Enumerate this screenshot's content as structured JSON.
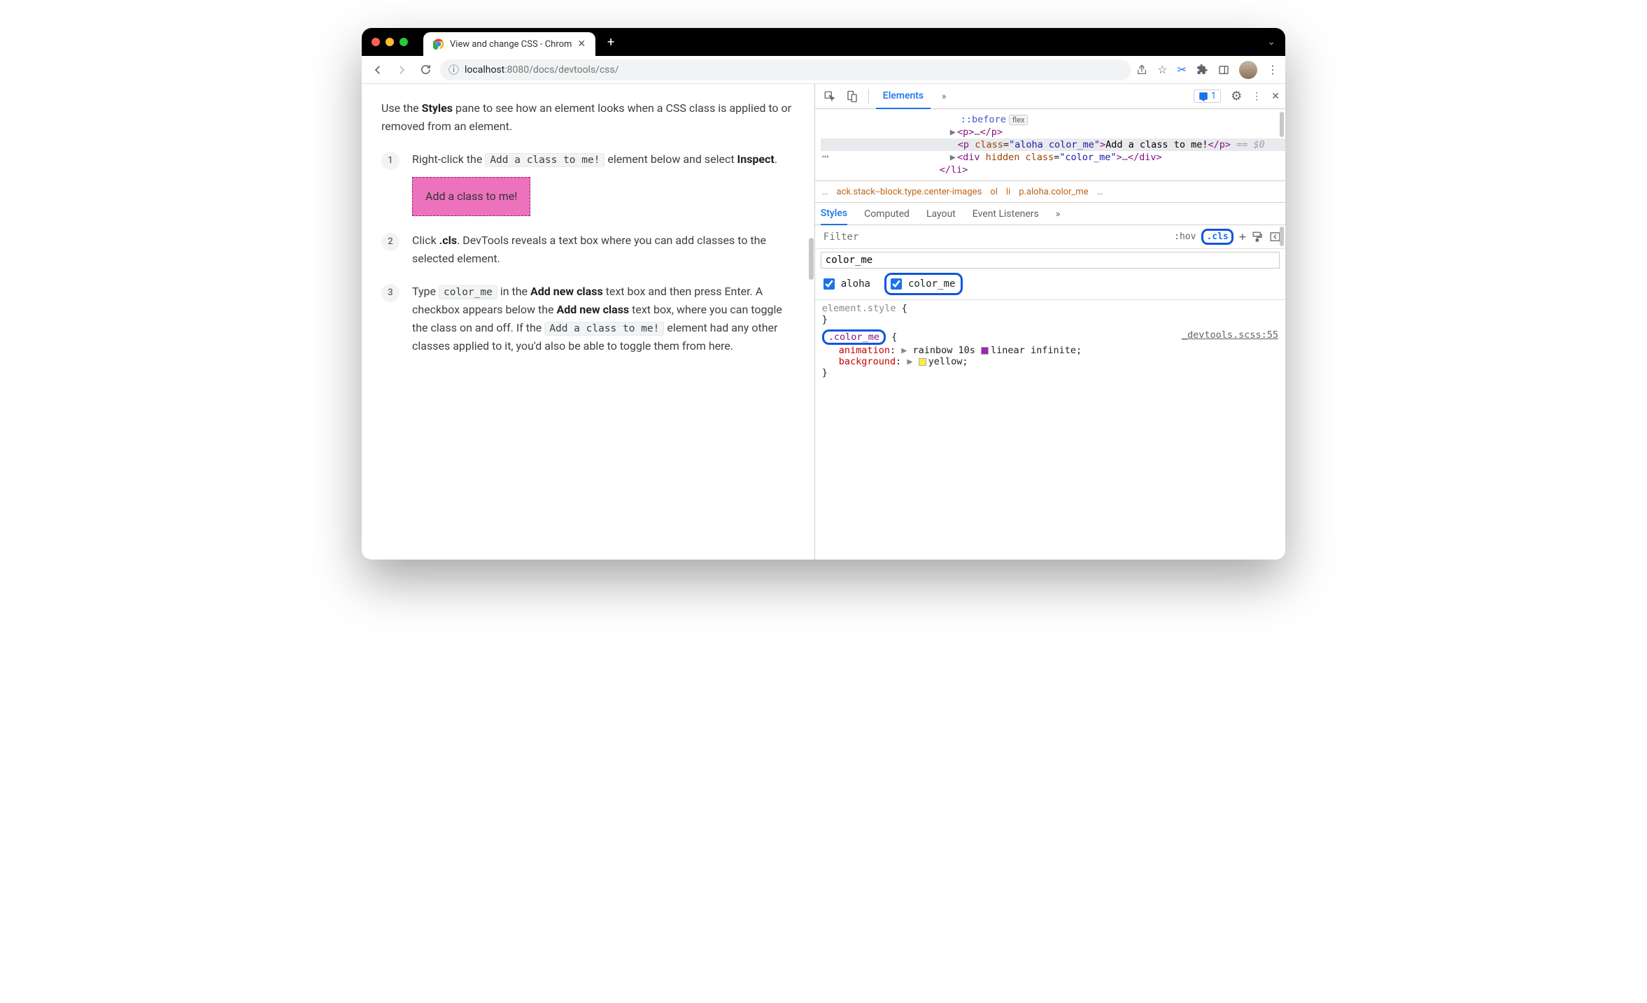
{
  "browser": {
    "tab_title": "View and change CSS - Chrom",
    "url_host": "localhost",
    "url_port": ":8080",
    "url_path": "/docs/devtools/css/"
  },
  "page": {
    "intro_a": "Use the ",
    "intro_b": "Styles",
    "intro_c": " pane to see how an element looks when a CSS class is applied to or removed from an element.",
    "s1_a": "Right-click the ",
    "s1_code": "Add a class to me!",
    "s1_b": " element below and select ",
    "s1_bold": "Inspect",
    "s1_c": ".",
    "demo": "Add a class to me!",
    "s2_a": "Click ",
    "s2_bold": ".cls",
    "s2_b": ". DevTools reveals a text box where you can add classes to the selected element.",
    "s3_a": "Type ",
    "s3_code": "color_me",
    "s3_b": " in the ",
    "s3_bold1": "Add new class",
    "s3_c": " text box and then press Enter. A checkbox appears below the ",
    "s3_bold2": "Add new class",
    "s3_d": " text box, where you can toggle the class on and off. If the ",
    "s3_code2": "Add a class to me!",
    "s3_e": " element had any other classes applied to it, you'd also be able to toggle them from here.",
    "n1": "1",
    "n2": "2",
    "n3": "3"
  },
  "dt": {
    "tab_elements": "Elements",
    "issues_count": "1",
    "crumb_trunc": "ack.stack--block.type.center-images",
    "crumb_ol": "ol",
    "crumb_li": "li",
    "crumb_sel": "p.aloha.color_me",
    "before": "::before",
    "flex": "flex",
    "p_open": "<p>",
    "p_ell": "…",
    "p_close": "</p>",
    "sel_open_a": "<p ",
    "sel_attr_n": "class",
    "sel_attr_v": "\"aloha color_me\"",
    "sel_open_b": ">",
    "sel_text": "Add a class to me!",
    "sel_close": "</p>",
    "sel_eq": " == ",
    "sel_ref": "$0",
    "div_a": "<div ",
    "div_hidden": "hidden",
    "div_cls_n": "class",
    "div_cls_v": "\"color_me\"",
    "div_b": ">",
    "div_ell": "…",
    "div_c": "</div>",
    "li_close": "</li>"
  },
  "styles": {
    "tab_styles": "Styles",
    "tab_computed": "Computed",
    "tab_layout": "Layout",
    "tab_events": "Event Listeners",
    "filter_ph": "Filter",
    "hov": ":hov",
    "cls": ".cls",
    "cls_input": "color_me",
    "chk_aloha": "aloha",
    "chk_colorme": "color_me",
    "elstyle": "element.style",
    "brace_o": " {",
    "brace_c": "}",
    "r_sel": ".color_me",
    "r_src": "_devtools.scss:55",
    "p_anim": "animation",
    "v_anim": "rainbow 10s ",
    "v_anim2": "linear infinite",
    "p_bg": "background",
    "v_bg": "yellow",
    "tri": "▶"
  }
}
